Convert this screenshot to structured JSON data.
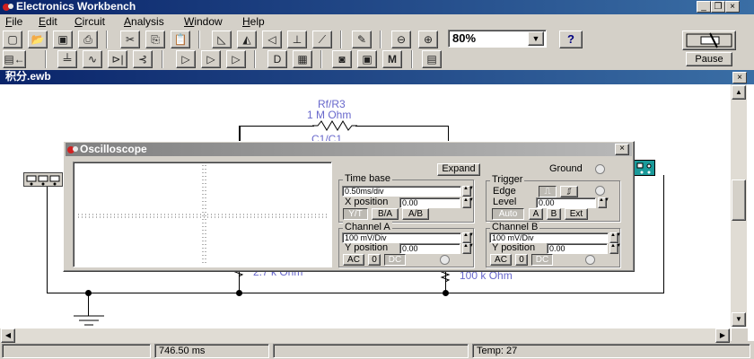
{
  "app": {
    "title": "Electronics Workbench"
  },
  "menu": [
    "File",
    "Edit",
    "Circuit",
    "Analysis",
    "Window",
    "Help"
  ],
  "toolbar": {
    "zoom_value": "80%",
    "help_label": "?",
    "pause_label": "Pause"
  },
  "circuit": {
    "title": "积分.ewb",
    "feedback_resistor": "Rf/R3",
    "feedback_value": "1 M Ohm",
    "capacitor_label": "C1/C1",
    "resistor_lower_left": "2.7 k Ohm",
    "resistor_lower_right": "100 k Ohm"
  },
  "oscilloscope": {
    "title": "Oscilloscope",
    "expand_label": "Expand",
    "ground_label": "Ground",
    "timebase": {
      "title": "Time base",
      "value": "0.50ms/div",
      "xpos_label": "X position",
      "xpos_value": "0.00",
      "modes": [
        "Y/T",
        "B/A",
        "A/B"
      ]
    },
    "trigger": {
      "title": "Trigger",
      "edge_label": "Edge",
      "level_label": "Level",
      "level_value": "0.00",
      "sources": [
        "Auto",
        "A",
        "B",
        "Ext"
      ]
    },
    "channel_a": {
      "title": "Channel A",
      "value": "100 mV/Div",
      "ypos_label": "Y position",
      "ypos_value": "0.00",
      "coupling": [
        "AC",
        "0",
        "DC"
      ]
    },
    "channel_b": {
      "title": "Channel B",
      "value": "100 mV/Div",
      "ypos_label": "Y position",
      "ypos_value": "0.00",
      "coupling": [
        "AC",
        "0",
        "DC"
      ]
    }
  },
  "status": {
    "time": "746.50 ms",
    "temp": "Temp:  27"
  }
}
